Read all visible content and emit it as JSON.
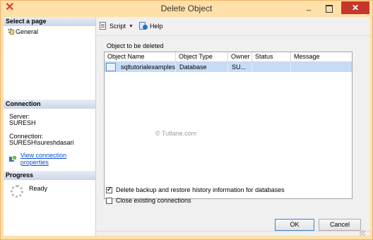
{
  "window": {
    "title": "Delete Object"
  },
  "left_pane": {
    "select_page_header": "Select a page",
    "pages": [
      {
        "label": "General",
        "icon": "general-page-icon"
      }
    ],
    "connection_header": "Connection",
    "server_label": "Server:",
    "server_value": "SURESH",
    "connection_label": "Connection:",
    "connection_value": "SURESH\\sureshdasari",
    "view_props_link": "View connection properties",
    "progress_header": "Progress",
    "progress_status": "Ready"
  },
  "toolbar": {
    "script_label": "Script",
    "help_label": "Help"
  },
  "main": {
    "section_label": "Object to be deleted",
    "columns": [
      "Object Name",
      "Object Type",
      "Owner",
      "Status",
      "Message"
    ],
    "rows": [
      {
        "name": "sqltutorialexamples",
        "type": "Database",
        "owner": "SU...",
        "status": "",
        "message": ""
      }
    ],
    "watermark": "© Tutlane.com",
    "checkbox_delete_history": {
      "label": "Delete backup and restore history information for databases",
      "checked": true
    },
    "checkbox_close_connections": {
      "label": "Close existing connections",
      "checked": false
    }
  },
  "buttons": {
    "ok": "OK",
    "cancel": "Cancel"
  },
  "colors": {
    "title_bar": "#ffe0a8",
    "close_button": "#c7362c",
    "selected_row": "#c6dcf4",
    "link": "#0b4fd0"
  }
}
